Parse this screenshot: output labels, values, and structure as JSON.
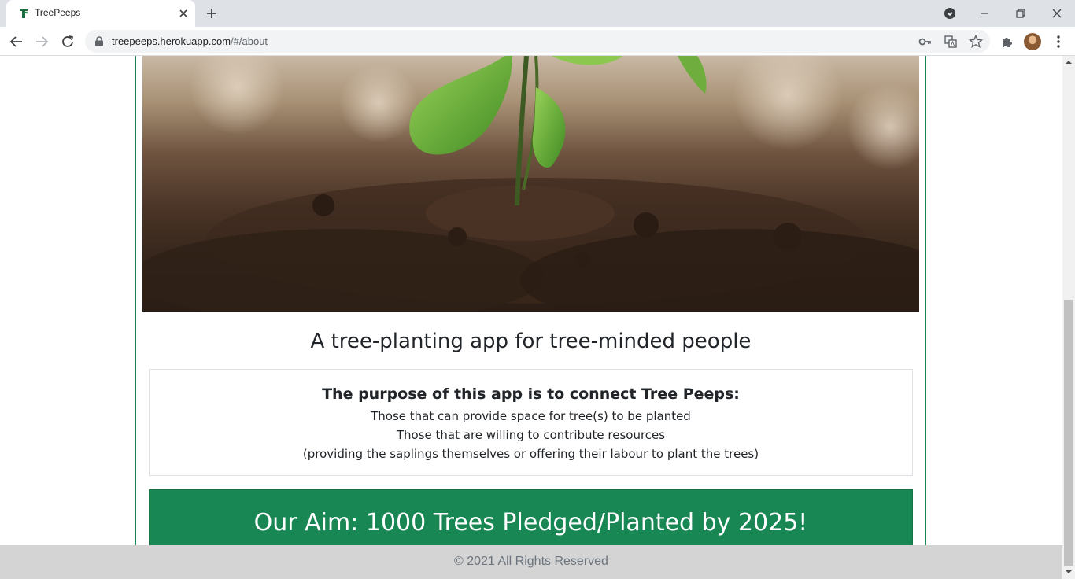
{
  "browser": {
    "tab_title": "TreePeeps",
    "url_host": "treepeeps.herokuapp.com",
    "url_path": "/#/about"
  },
  "hero": {
    "image_alt": "Sapling growing from soil"
  },
  "about": {
    "headline": "A tree-planting app for tree-minded people",
    "purpose_title": "The purpose of this app is to connect Tree Peeps:",
    "purpose_lines": [
      "Those that can provide space for tree(s) to be planted",
      "Those that are willing to contribute resources",
      "(providing the saplings themselves or offering their labour to plant the trees)"
    ],
    "aim": "Our Aim: 1000 Trees Pledged/Planted by 2025!"
  },
  "footer": {
    "copyright": "© 2021 All Rights Reserved"
  },
  "colors": {
    "brand_green": "#198754",
    "footer_bg": "#d4d4d4"
  }
}
